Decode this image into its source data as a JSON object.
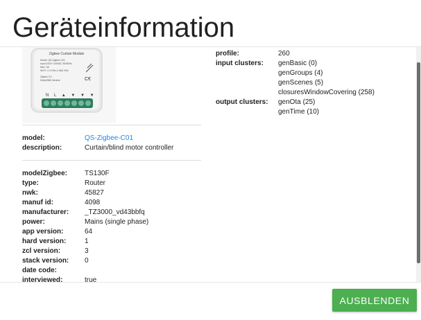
{
  "dialog": {
    "title": "Geräteinformation",
    "hide_button": "AUSBLENDEN"
  },
  "device_image": {
    "header": "Zigbee Curtain Module",
    "lines": [
      "Model: QS-Zigbee-C01",
      "Input:220V~240VAC 50/60Hz",
      "Max. 3A",
      "Wi-Fi: 2.4 GHz-2.484 GHz",
      "Zigbee 3.0",
      "Noby/With Neutral"
    ],
    "terminals": "N L ▲ ▼ ▼ ▼"
  },
  "left": {
    "model": {
      "label": "model:",
      "value": "QS-Zigbee-C01"
    },
    "description": {
      "label": "description:",
      "value": "Curtain/blind motor controller"
    },
    "details": [
      {
        "label": "modelZigbee:",
        "value": "TS130F"
      },
      {
        "label": "type:",
        "value": "Router"
      },
      {
        "label": "nwk:",
        "value": "45827"
      },
      {
        "label": "manuf id:",
        "value": "4098"
      },
      {
        "label": "manufacturer:",
        "value": "_TZ3000_vd43bbfq"
      },
      {
        "label": "power:",
        "value": "Mains (single phase)"
      },
      {
        "label": "app version:",
        "value": "64"
      },
      {
        "label": "hard version:",
        "value": "1"
      },
      {
        "label": "zcl version:",
        "value": "3"
      },
      {
        "label": "stack version:",
        "value": "0"
      },
      {
        "label": "date code:",
        "value": ""
      },
      {
        "label": "interviewed:",
        "value": "true"
      }
    ]
  },
  "right": {
    "profile": {
      "label": "profile:",
      "value": "260"
    },
    "input_clusters": {
      "label": "input clusters:",
      "values": [
        "genBasic (0)",
        "genGroups (4)",
        "genScenes (5)",
        "closuresWindowCovering (258)"
      ]
    },
    "output_clusters": {
      "label": "output clusters:",
      "values": [
        "genOta (25)",
        "genTime (10)"
      ]
    }
  },
  "colors": {
    "accent": "#4caf50",
    "link": "#1e88e5"
  }
}
